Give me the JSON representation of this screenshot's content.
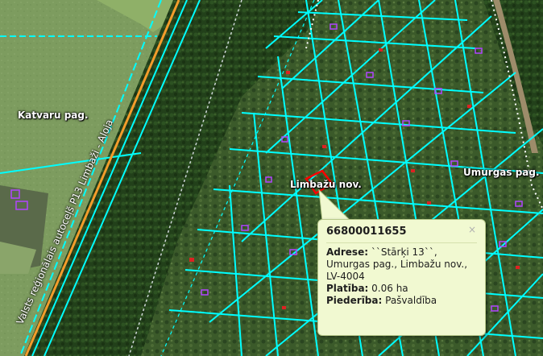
{
  "map": {
    "labels": {
      "katvaru": "Katvaru pag.",
      "limbazu": "Limbažu nov.",
      "umurgas": "Umurgas pag."
    },
    "road_label": "Valsts reģionālais autoceļš P13 Limbaži - Aloja",
    "colors": {
      "parcel_outline": "#00ffff",
      "selected_parcel": "#ff0000",
      "road": "#f39c2b",
      "building": "#b144ff",
      "field": "#7a9a5c",
      "forest": "#1f3d18"
    }
  },
  "popup": {
    "title": "66800011655",
    "close_glyph": "×",
    "rows": [
      {
        "label": "Adrese:",
        "value": "``Stārķi 13``, Umurgas pag., Limbažu nov., LV-4004"
      },
      {
        "label": "Platība:",
        "value": "0.06 ha"
      },
      {
        "label": "Piederība:",
        "value": "Pašvaldība"
      }
    ]
  }
}
